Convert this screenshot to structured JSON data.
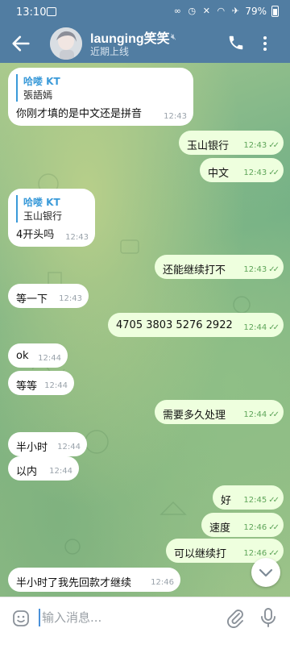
{
  "status_bar": {
    "time": "13:10",
    "battery": "79%"
  },
  "header": {
    "title": "launging笑笑",
    "subtitle": "近期上线"
  },
  "messages": [
    {
      "reply_name": "哈喽 KT",
      "reply_text": "張語嫣",
      "text": "你刚才填的是中文还是拼音",
      "time": "12:43"
    },
    {
      "text": "玉山银行",
      "time": "12:43"
    },
    {
      "text": "中文",
      "time": "12:43"
    },
    {
      "reply_name": "哈喽 KT",
      "reply_text": "玉山银行",
      "text": "4开头吗",
      "time": "12:43"
    },
    {
      "text": "还能继续打不",
      "time": "12:43"
    },
    {
      "text": "等一下",
      "time": "12:43"
    },
    {
      "text": "4705 3803 5276 2922",
      "time": "12:44"
    },
    {
      "text": "ok",
      "time": "12:44"
    },
    {
      "text": "等等",
      "time": "12:44"
    },
    {
      "text": "需要多久处理",
      "time": "12:44"
    },
    {
      "text": "半小时",
      "time": "12:44"
    },
    {
      "text": "以内",
      "time": "12:44"
    },
    {
      "text": "好",
      "time": "12:45"
    },
    {
      "text": "速度",
      "time": "12:46"
    },
    {
      "text": "可以继续打",
      "time": "12:46"
    },
    {
      "text": "半小时了我先回款才继续",
      "time": "12:46"
    }
  ],
  "input": {
    "placeholder": "输入消息..."
  }
}
